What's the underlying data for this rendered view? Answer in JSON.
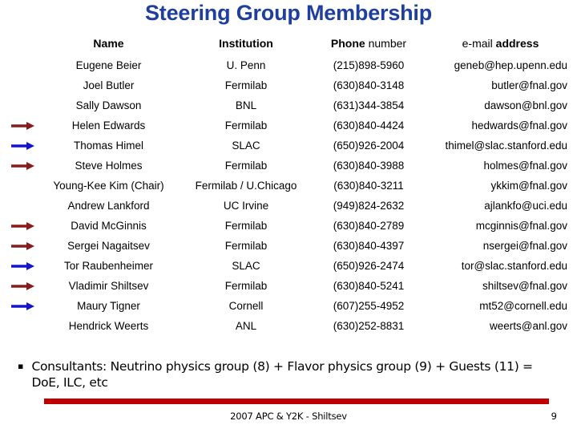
{
  "slide": {
    "title": "Steering Group Membership"
  },
  "table": {
    "headers": {
      "name": "Name",
      "institution": "Institution",
      "phone_bold": "Phone",
      "phone_rest": " number",
      "email_rest": "e-mail ",
      "email_bold": "address"
    },
    "rows": [
      {
        "arrow": "none",
        "arrow_color": "",
        "name": "Eugene Beier",
        "institution": "U. Penn",
        "phone": "(215)898-5960",
        "email": "geneb@hep.upenn.edu"
      },
      {
        "arrow": "none",
        "arrow_color": "",
        "name": "Joel Butler",
        "institution": "Fermilab",
        "phone": "(630)840-3148",
        "email": "butler@fnal.gov"
      },
      {
        "arrow": "none",
        "arrow_color": "",
        "name": "Sally Dawson",
        "institution": "BNL",
        "phone": "(631)344-3854",
        "email": "dawson@bnl.gov"
      },
      {
        "arrow": "right-arrow-icon",
        "arrow_color": "#8B1A1A",
        "name": "Helen Edwards",
        "institution": "Fermilab",
        "phone": "(630)840-4424",
        "email": "hedwards@fnal.gov"
      },
      {
        "arrow": "right-arrow-icon",
        "arrow_color": "#1414CC",
        "name": "Thomas Himel",
        "institution": "SLAC",
        "phone": "(650)926-2004",
        "email": "thimel@slac.stanford.edu"
      },
      {
        "arrow": "right-arrow-icon",
        "arrow_color": "#8B1A1A",
        "name": "Steve Holmes",
        "institution": "Fermilab",
        "phone": "(630)840-3988",
        "email": "holmes@fnal.gov"
      },
      {
        "arrow": "none",
        "arrow_color": "",
        "name": "Young-Kee Kim (Chair)",
        "institution": "Fermilab / U.Chicago",
        "phone": "(630)840-3211",
        "email": "ykkim@fnal.gov"
      },
      {
        "arrow": "none",
        "arrow_color": "",
        "name": "Andrew Lankford",
        "institution": "UC Irvine",
        "phone": "(949)824-2632",
        "email": "ajlankfo@uci.edu"
      },
      {
        "arrow": "right-arrow-icon",
        "arrow_color": "#8B1A1A",
        "name": "David McGinnis",
        "institution": "Fermilab",
        "phone": "(630)840-2789",
        "email": "mcginnis@fnal.gov"
      },
      {
        "arrow": "right-arrow-icon",
        "arrow_color": "#8B1A1A",
        "name": "Sergei Nagaitsev",
        "institution": "Fermilab",
        "phone": "(630)840-4397",
        "email": "nsergei@fnal.gov"
      },
      {
        "arrow": "right-arrow-icon",
        "arrow_color": "#1414CC",
        "name": "Tor Raubenheimer",
        "institution": "SLAC",
        "phone": "(650)926-2474",
        "email": "tor@slac.stanford.edu"
      },
      {
        "arrow": "right-arrow-icon",
        "arrow_color": "#8B1A1A",
        "name": "Vladimir Shiltsev",
        "institution": "Fermilab",
        "phone": "(630)840-5241",
        "email": "shiltsev@fnal.gov"
      },
      {
        "arrow": "right-arrow-icon",
        "arrow_color": "#1414CC",
        "name": "Maury Tigner",
        "institution": "Cornell",
        "phone": "(607)255-4952",
        "email": "mt52@cornell.edu"
      },
      {
        "arrow": "none",
        "arrow_color": "",
        "name": "Hendrick Weerts",
        "institution": "ANL",
        "phone": "(630)252-8831",
        "email": "weerts@anl.gov"
      }
    ]
  },
  "bullet": {
    "marker": "▪",
    "text": "Consultants: Neutrino physics group (8) + Flavor physics group (9) + Guests (11) = DoE, ILC, etc"
  },
  "footer": {
    "center": "2007 APC & Y2K - Shiltsev",
    "page": "9"
  },
  "colors": {
    "title": "#1F3F9E",
    "rule": "#C00000",
    "arrow_red": "#8B1A1A",
    "arrow_blue": "#1414CC"
  }
}
